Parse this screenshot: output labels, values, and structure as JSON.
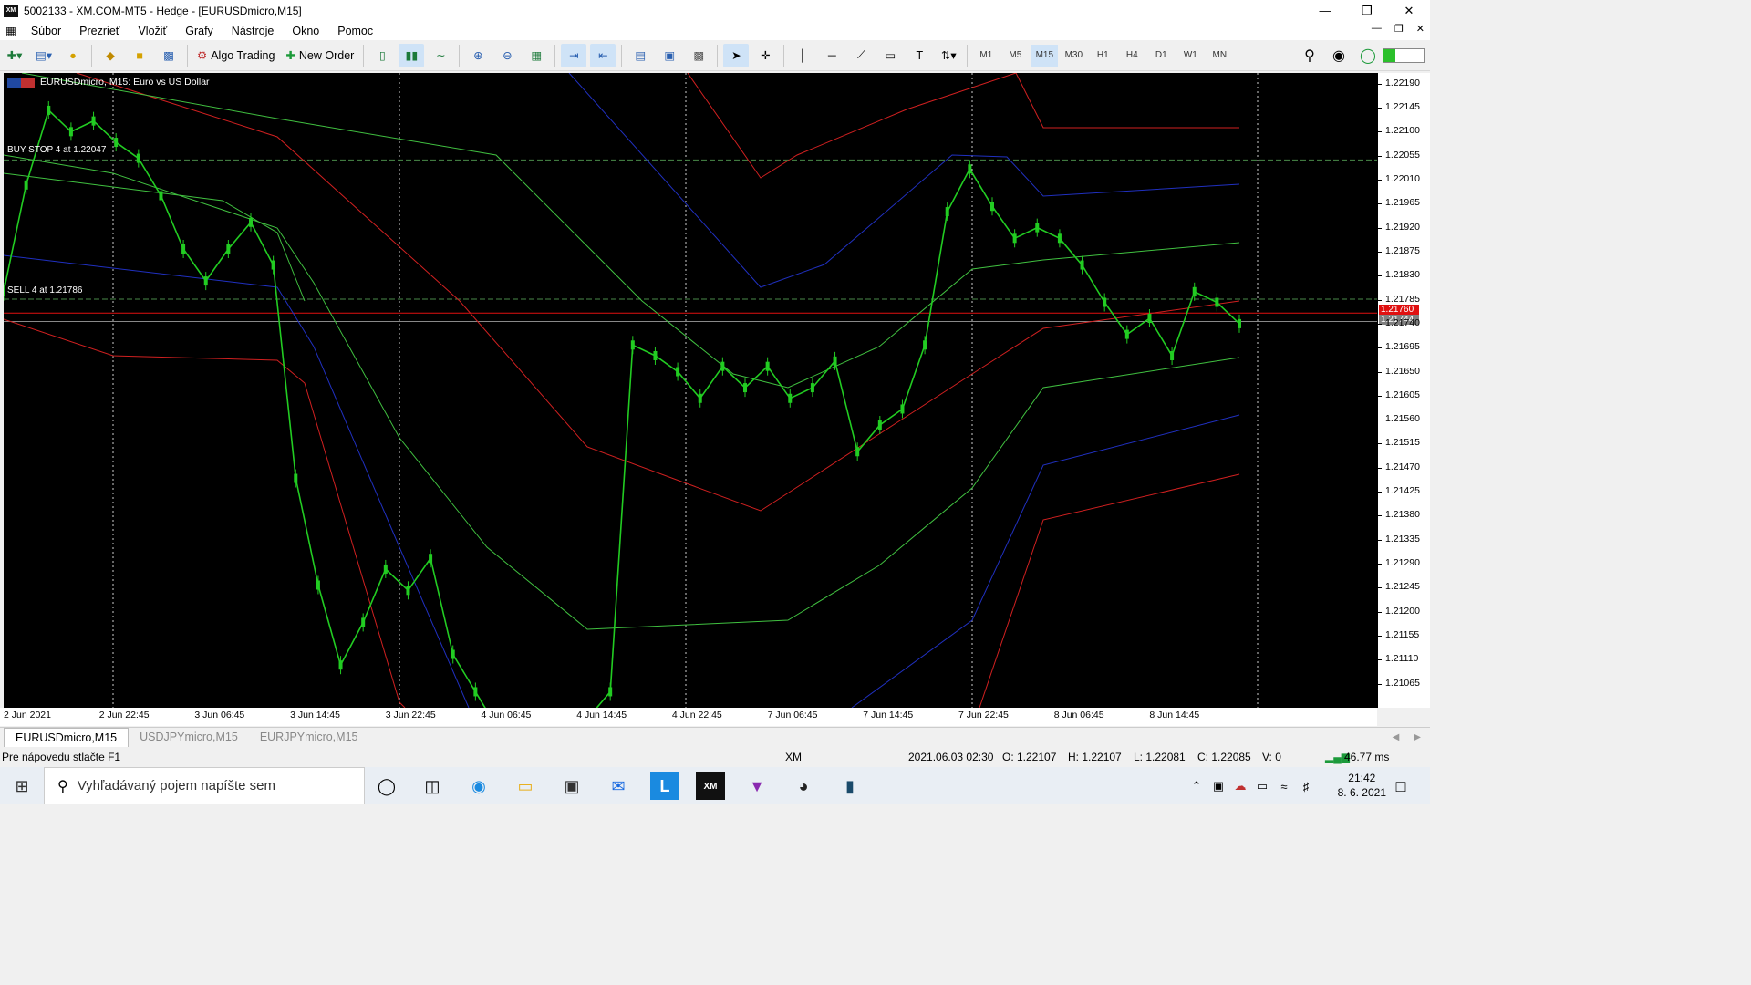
{
  "window": {
    "title": "5002133 - XM.COM-MT5 - Hedge - [EURUSDmicro,M15]",
    "app_icon_text": "XM"
  },
  "menu": [
    "Súbor",
    "Prezrieť",
    "Vložiť",
    "Grafy",
    "Nástroje",
    "Okno",
    "Pomoc"
  ],
  "toolbar": {
    "algo_trading": "Algo Trading",
    "new_order": "New Order",
    "timeframes": [
      "M1",
      "M5",
      "M15",
      "M30",
      "H1",
      "H4",
      "D1",
      "W1",
      "MN"
    ],
    "active_timeframe": "M15"
  },
  "chart": {
    "header": "EURUSDmicro, M15:  Euro vs US Dollar",
    "buy_stop_label": "BUY STOP 4 at 1.22047",
    "sell_label": "SELL 4 at 1.21786",
    "bid_tag": "1.21760",
    "ask_tag": "1.21744",
    "price_ticks": [
      "1.22190",
      "1.22145",
      "1.22100",
      "1.22055",
      "1.22010",
      "1.21965",
      "1.21920",
      "1.21875",
      "1.21830",
      "1.21785",
      "1.21740",
      "1.21695",
      "1.21650",
      "1.21605",
      "1.21560",
      "1.21515",
      "1.21470",
      "1.21425",
      "1.21380",
      "1.21335",
      "1.21290",
      "1.21245",
      "1.21200",
      "1.21155",
      "1.21110",
      "1.21065"
    ],
    "time_ticks": [
      "2 Jun 2021",
      "2 Jun 22:45",
      "3 Jun 06:45",
      "3 Jun 14:45",
      "3 Jun 22:45",
      "4 Jun 06:45",
      "4 Jun 14:45",
      "4 Jun 22:45",
      "7 Jun 06:45",
      "7 Jun 14:45",
      "7 Jun 22:45",
      "8 Jun 06:45",
      "8 Jun 14:45"
    ]
  },
  "chart_data": {
    "type": "line",
    "symbol": "EURUSDmicro",
    "timeframe": "M15",
    "ylim": [
      1.2102,
      1.2221
    ],
    "orders": [
      {
        "label": "BUY STOP 4 at 1.22047",
        "price": 1.22047
      },
      {
        "label": "SELL 4 at 1.21786",
        "price": 1.21786
      }
    ],
    "bid": 1.2176,
    "ask": 1.21744,
    "series": [
      {
        "name": "",
        "color": "#22cc22",
        "values": [
          1.218,
          1.22,
          1.2214,
          1.221,
          1.2212,
          1.2208,
          1.2205,
          1.2198,
          1.2188,
          1.2182,
          1.2188,
          1.2193,
          1.2185,
          1.2145,
          1.2125,
          1.211,
          1.2118,
          1.2128,
          1.2124,
          1.213,
          1.2112,
          1.2105,
          1.2098,
          1.209,
          1.2092,
          1.2095,
          1.21,
          1.2105,
          1.217,
          1.2168,
          1.2165,
          1.216,
          1.2166,
          1.2162,
          1.2166,
          1.216,
          1.2162,
          1.2167,
          1.215,
          1.2155,
          1.2158,
          1.217,
          1.2195,
          1.2203,
          1.2196,
          1.219,
          1.2192,
          1.219,
          1.2185,
          1.2178,
          1.2172,
          1.2175,
          1.2168,
          1.218,
          1.2178,
          1.2174
        ]
      }
    ]
  },
  "tabs": [
    "EURUSDmicro,M15",
    "USDJPYmicro,M15",
    "EURJPYmicro,M15"
  ],
  "status": {
    "help": "Pre nápovedu stlačte F1",
    "profile": "XM",
    "datetime": "2021.06.03 02:30",
    "open": "O: 1.22107",
    "high": "H: 1.22107",
    "low": "L: 1.22081",
    "close": "C: 1.22085",
    "volume": "V: 0",
    "ping": "46.77 ms"
  },
  "taskbar": {
    "search_placeholder": "Vyhľadávaný pojem napíšte sem",
    "time": "21:42",
    "date": "8. 6. 2021"
  }
}
